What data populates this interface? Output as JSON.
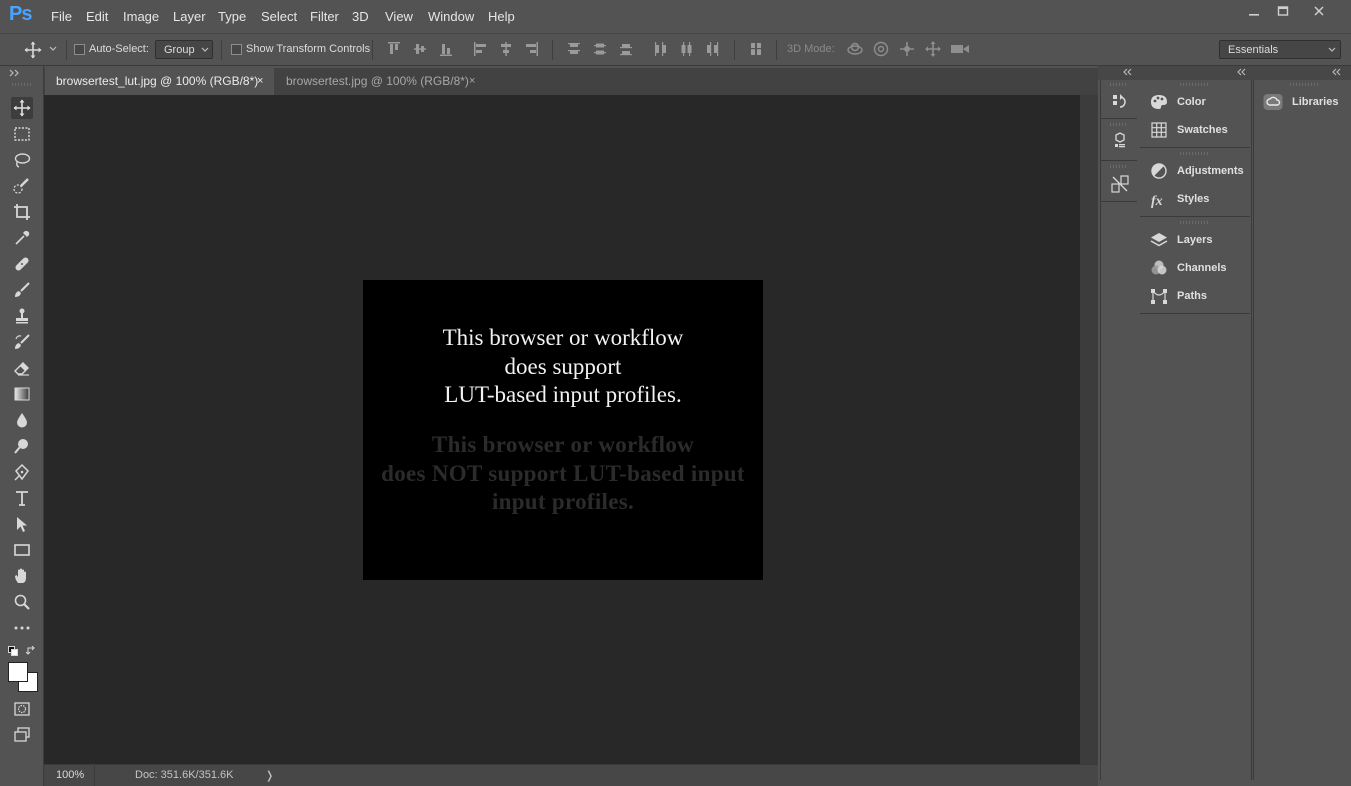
{
  "app": {
    "logo": "Ps"
  },
  "menu": [
    "File",
    "Edit",
    "Image",
    "Layer",
    "Type",
    "Select",
    "Filter",
    "3D",
    "View",
    "Window",
    "Help"
  ],
  "options": {
    "auto_select_label": "Auto-Select:",
    "auto_select_value": "Group",
    "show_transform_label": "Show Transform Controls",
    "mode_3d_label": "3D Mode:",
    "workspace": "Essentials"
  },
  "tabs": [
    {
      "label": "browsertest_lut.jpg @ 100% (RGB/8*)",
      "active": true
    },
    {
      "label": "browsertest.jpg @ 100% (RGB/8*)",
      "active": false
    }
  ],
  "close_glyph": "×",
  "document": {
    "lines": [
      "This browser or workflow",
      "does support",
      "LUT-based input profiles."
    ],
    "hidden_lines": [
      "This browser or workflow",
      "does NOT support LUT-based input",
      "input profiles."
    ]
  },
  "status": {
    "zoom": "100%",
    "doc": "Doc: 351.6K/351.6K",
    "arrow": "❭"
  },
  "panels": {
    "group1": [
      "Color",
      "Swatches"
    ],
    "group2": [
      "Adjustments",
      "Styles"
    ],
    "group3": [
      "Layers",
      "Channels",
      "Paths"
    ],
    "libraries": "Libraries"
  },
  "colors": {
    "accent": "#4aa3ff",
    "ui_bg": "#535353",
    "canvas_bg": "#282828"
  }
}
